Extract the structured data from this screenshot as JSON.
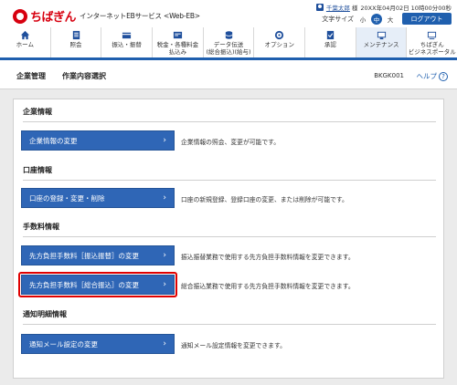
{
  "header": {
    "logo_text": "ちばぎん",
    "service_name": "インターネットEBサービス <Web-EB>",
    "user_name": "千葉太郎",
    "user_suffix": "様",
    "login_time": "20XX年04月02日 10時00分00秒",
    "text_size_label": "文字サイズ",
    "size_small": "小",
    "size_medium": "中",
    "size_large": "大",
    "logout_label": "ログアウト"
  },
  "nav": {
    "items": [
      {
        "label": "ホーム",
        "icon": "home-icon"
      },
      {
        "label": "照会",
        "icon": "inquiry-icon"
      },
      {
        "label": "振込・振替",
        "icon": "transfer-icon"
      },
      {
        "label": "税金・各種料金\n払込み",
        "icon": "payment-icon"
      },
      {
        "label": "データ伝送\n(総合振込)(給与)",
        "icon": "data-transfer-icon"
      },
      {
        "label": "オプション",
        "icon": "option-icon"
      },
      {
        "label": "承認",
        "icon": "approval-icon"
      },
      {
        "label": "メンテナンス",
        "icon": "maintenance-icon"
      },
      {
        "label": "ちばぎん\nビジネスポータル",
        "icon": "portal-icon"
      }
    ],
    "active_index": 7
  },
  "titlebar": {
    "main": "企業管理",
    "sub": "作業内容選択",
    "screen_id": "BKGK001",
    "help_label": "ヘルプ",
    "help_icon": "?"
  },
  "sections": [
    {
      "heading": "企業情報",
      "buttons": [
        {
          "label": "企業情報の変更",
          "desc": "企業情報の照会、変更が可能です。"
        }
      ]
    },
    {
      "heading": "口座情報",
      "buttons": [
        {
          "label": "口座の登録・変更・削除",
          "desc": "口座の新規登録、登録口座の変更、または削除が可能です。"
        }
      ]
    },
    {
      "heading": "手数料情報",
      "buttons": [
        {
          "label": "先方負担手数料［振込振替］の変更",
          "desc": "振込振替業務で使用する先方負担手数料情報を変更できます。"
        },
        {
          "label": "先方負担手数料［総合振込］の変更",
          "desc": "総合振込業務で使用する先方負担手数料情報を変更できます。"
        }
      ]
    },
    {
      "heading": "通知明細情報",
      "buttons": [
        {
          "label": "通知メール設定の変更",
          "desc": "通知メール設定情報を変更できます。"
        }
      ]
    }
  ],
  "chevron": "›",
  "colors": {
    "brand_red": "#d7000f",
    "primary_blue": "#2f66b6",
    "highlight_red": "#e00000"
  }
}
